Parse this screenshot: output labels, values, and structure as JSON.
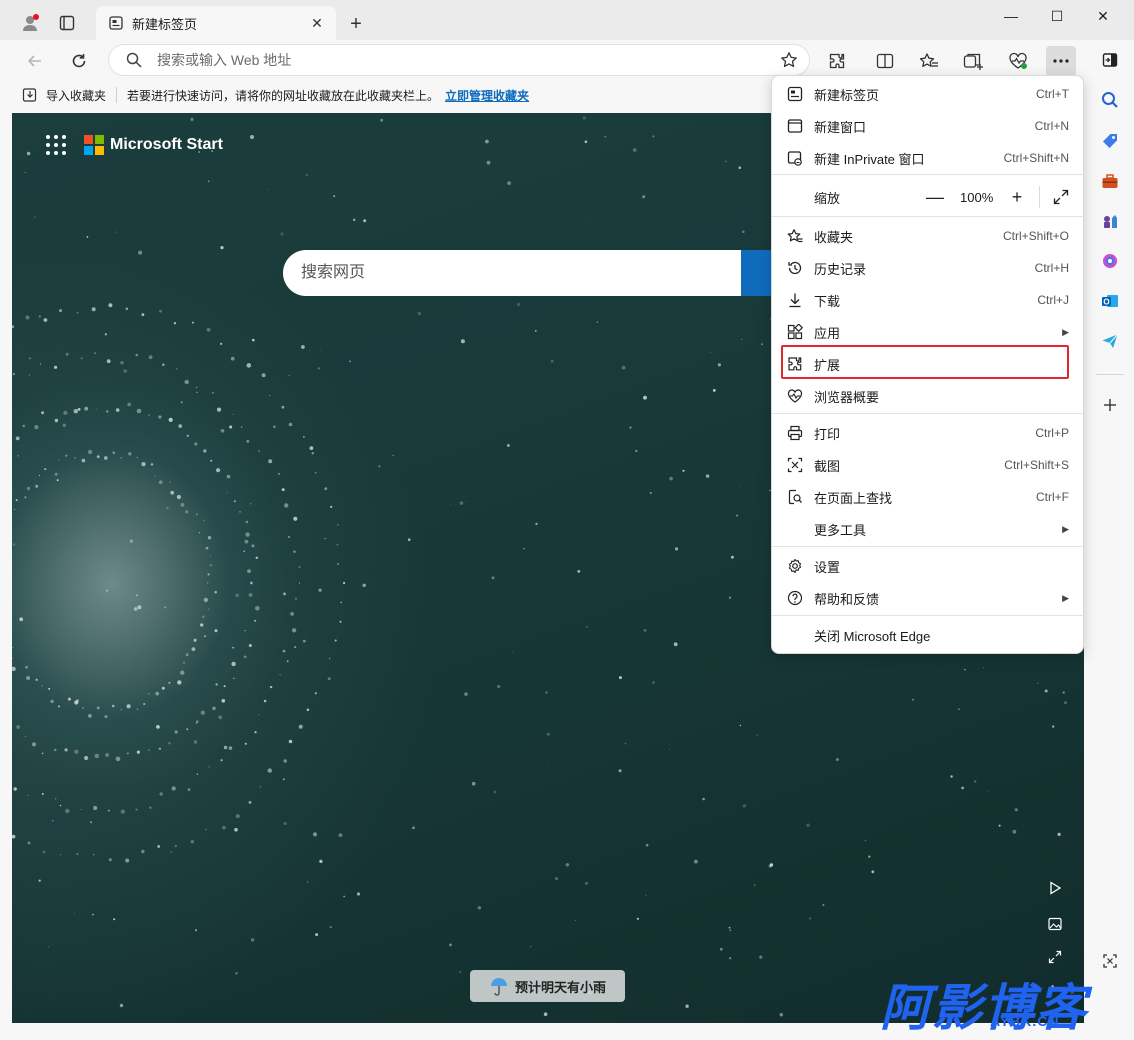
{
  "tab": {
    "title": "新建标签页",
    "close": "✕"
  },
  "new_tab_symbol": "+",
  "window_controls": {
    "minimize": "—",
    "maximize": "☐",
    "close": "✕"
  },
  "address_bar": {
    "placeholder": "搜索或输入 Web 地址",
    "value": ""
  },
  "favorites_bar": {
    "import_label": "导入收藏夹",
    "message": "若要进行快速访问，请将你的网址收藏放在此收藏夹栏上。",
    "manage_link": "立即管理收藏夹"
  },
  "newtab_page": {
    "brand": "Microsoft Start",
    "search_placeholder": "搜索网页",
    "weather": "预计明天有小雨",
    "brand_colors": [
      "#f25022",
      "#7fba00",
      "#00a4ef",
      "#ffb900"
    ]
  },
  "menu": {
    "items": [
      {
        "label": "新建标签页",
        "shortcut": "Ctrl+T",
        "icon": "new-tab-icon"
      },
      {
        "label": "新建窗口",
        "shortcut": "Ctrl+N",
        "icon": "new-window-icon"
      },
      {
        "label": "新建 InPrivate 窗口",
        "shortcut": "Ctrl+Shift+N",
        "icon": "inprivate-icon"
      },
      {
        "label": "缩放",
        "shortcut": "",
        "icon": ""
      },
      {
        "label": "收藏夹",
        "shortcut": "Ctrl+Shift+O",
        "icon": "favorites-icon"
      },
      {
        "label": "历史记录",
        "shortcut": "Ctrl+H",
        "icon": "history-icon"
      },
      {
        "label": "下载",
        "shortcut": "Ctrl+J",
        "icon": "download-icon"
      },
      {
        "label": "应用",
        "shortcut": "",
        "icon": "apps-icon"
      },
      {
        "label": "扩展",
        "shortcut": "",
        "icon": "extensions-icon"
      },
      {
        "label": "浏览器概要",
        "shortcut": "",
        "icon": "browser-essentials-icon"
      },
      {
        "label": "打印",
        "shortcut": "Ctrl+P",
        "icon": "print-icon"
      },
      {
        "label": "截图",
        "shortcut": "Ctrl+Shift+S",
        "icon": "screenshot-icon"
      },
      {
        "label": "在页面上查找",
        "shortcut": "Ctrl+F",
        "icon": "find-icon"
      },
      {
        "label": "更多工具",
        "shortcut": "",
        "icon": ""
      },
      {
        "label": "设置",
        "shortcut": "",
        "icon": "settings-icon"
      },
      {
        "label": "帮助和反馈",
        "shortcut": "",
        "icon": "help-icon"
      },
      {
        "label": "关闭 Microsoft Edge",
        "shortcut": "",
        "icon": ""
      }
    ],
    "zoom": {
      "minus": "—",
      "value": "100%",
      "plus": "+"
    },
    "highlight_color": "#e0292e"
  },
  "watermark": {
    "main": "阿影博客",
    "sub": "AYBK.CN",
    "color": "#1f63f0"
  },
  "accent_color": "#0f6cbd"
}
